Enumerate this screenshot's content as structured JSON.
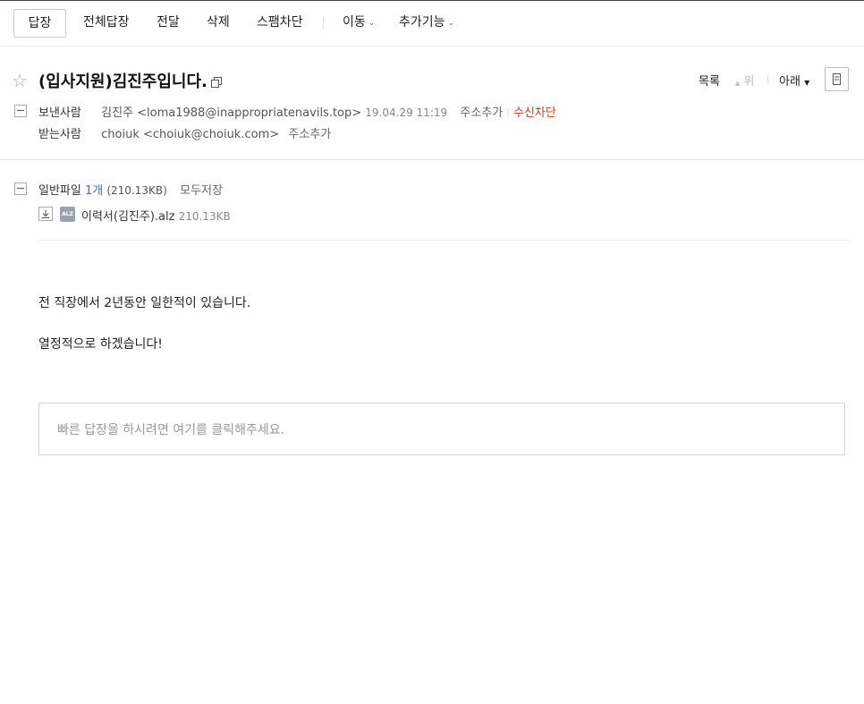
{
  "toolbar": {
    "reply": "답장",
    "reply_all": "전체답장",
    "forward": "전달",
    "delete": "삭제",
    "spam_block": "스팸차단",
    "move": "이동",
    "more": "추가기능"
  },
  "message": {
    "subject": "(입사지원)김진주입니다.",
    "nav": {
      "list": "목록",
      "up": "위",
      "down": "아래"
    },
    "sender": {
      "label": "보낸사람",
      "name": "김진주",
      "email": "<loma1988@inappropriatenavils.top>",
      "date": "19.04.29 11:19",
      "add_address": "주소추가",
      "block": "수신차단"
    },
    "recipient": {
      "label": "받는사람",
      "name": "choiuk",
      "email": "<choiuk@choiuk.com>",
      "add_address": "주소추가"
    }
  },
  "attachments": {
    "label": "일반파일",
    "count": "1개",
    "total_size": "(210.13KB)",
    "save_all": "모두저장",
    "files": [
      {
        "name": "이력서(김진주).alz",
        "size": "210.13KB",
        "ext": "ALZ"
      }
    ]
  },
  "body": {
    "line1": "전 직장에서 2년동안 일한적이 있습니다.",
    "line2": "열정적으로 하겠습니다!"
  },
  "quick_reply": {
    "placeholder": "빠른 답장을 하시려면 여기를 클릭해주세요."
  }
}
